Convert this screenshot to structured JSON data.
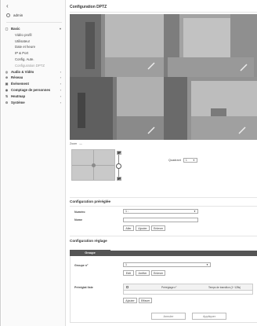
{
  "sidebar": {
    "back_glyph": "‹",
    "user": "admin",
    "items": [
      {
        "label": "Basic",
        "icon": "camera-icon",
        "glyph": "▢",
        "level": "top",
        "chev": "▾"
      },
      {
        "label": "Vidéo profil",
        "level": "sub"
      },
      {
        "label": "Utilisateur",
        "level": "sub"
      },
      {
        "label": "Date et heure",
        "level": "sub"
      },
      {
        "label": "IP & Port",
        "level": "sub"
      },
      {
        "label": "Config. Aute.",
        "level": "sub"
      },
      {
        "label": "Configuration DPTZ",
        "level": "sub",
        "active": true
      },
      {
        "label": "Audio & Vidéo",
        "icon": "audio-video-icon",
        "glyph": "◎",
        "level": "top",
        "chev": "›"
      },
      {
        "label": "Réseau",
        "icon": "network-icon",
        "glyph": "⊕",
        "level": "top",
        "chev": "›"
      },
      {
        "label": "Événement",
        "icon": "event-icon",
        "glyph": "▣",
        "level": "top",
        "chev": "›"
      },
      {
        "label": "Comptage de personnes",
        "icon": "people-count-icon",
        "glyph": "◉",
        "level": "top",
        "chev": "›"
      },
      {
        "label": "Heatmap",
        "icon": "heatmap-icon",
        "glyph": "⇅",
        "level": "top",
        "chev": "›"
      },
      {
        "label": "Système",
        "icon": "system-icon",
        "glyph": "⚙",
        "level": "top",
        "chev": "›"
      }
    ]
  },
  "main": {
    "title": "Configuration DPTZ",
    "zoom_label": "Zoom",
    "zoom_toggle": "—",
    "quadrant_label": "Quadrant",
    "quadrant_value": "1",
    "ptz_plus": "+",
    "ptz_minus": "−"
  },
  "preset": {
    "title": "Configuration préréglée",
    "number_label": "Numéro",
    "number_value": "1 :",
    "name_label": "Nome",
    "name_value": "",
    "buttons": {
      "go": "Aller",
      "add": "Ajouter",
      "remove": "Enlever"
    }
  },
  "group": {
    "title": "Configuration réglage",
    "tab": "Groupe",
    "group_label": "Groupe n°",
    "group_value": "1",
    "buttons": {
      "edit": "Edit",
      "stop": "Arrêter",
      "remove": "Enlever"
    },
    "preset_list_label": "Préréglat liste",
    "table_headers": [
      "Préréglage n°",
      "Temps de transition (1~128s)"
    ],
    "list_buttons": {
      "add": "Ajouter",
      "delete": "Effacer"
    }
  },
  "footer": {
    "cancel": "Annuler",
    "apply": "Appliquer"
  },
  "colors": {
    "tab_dark": "#555555",
    "pad": "#c9c9c9"
  }
}
